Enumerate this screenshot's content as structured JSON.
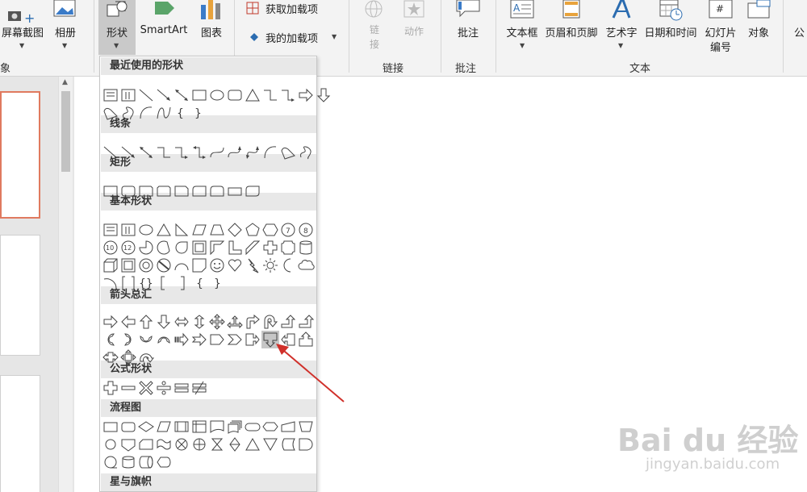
{
  "ribbon": {
    "screenshot_label": "屏幕截图",
    "album_label": "相册",
    "group_images": "象",
    "shapes_label": "形状",
    "smartart_label": "SmartArt",
    "chart_label": "图表",
    "get_addins": "获取加载项",
    "my_addins": "我的加载项",
    "link_label": "链\n接",
    "action_label": "动作",
    "group_links": "链接",
    "comment_label": "批注",
    "group_comments": "批注",
    "textbox_label": "文本框",
    "header_footer_label": "页眉和页脚",
    "wordart_label": "艺术字",
    "datetime_label": "日期和时间",
    "slide_number_label1": "幻灯片",
    "slide_number_label2": "编号",
    "object_label": "对象",
    "group_text": "文本",
    "cut_label": "公"
  },
  "menu": {
    "recent": "最近使用的形状",
    "lines": "线条",
    "rectangles": "矩形",
    "basic": "基本形状",
    "arrows": "箭头总汇",
    "equation": "公式形状",
    "flowchart": "流程图",
    "stars": "星与旗帜"
  },
  "watermark": {
    "brand": "Bai du 经验",
    "url": "jingyan.baidu.com"
  }
}
